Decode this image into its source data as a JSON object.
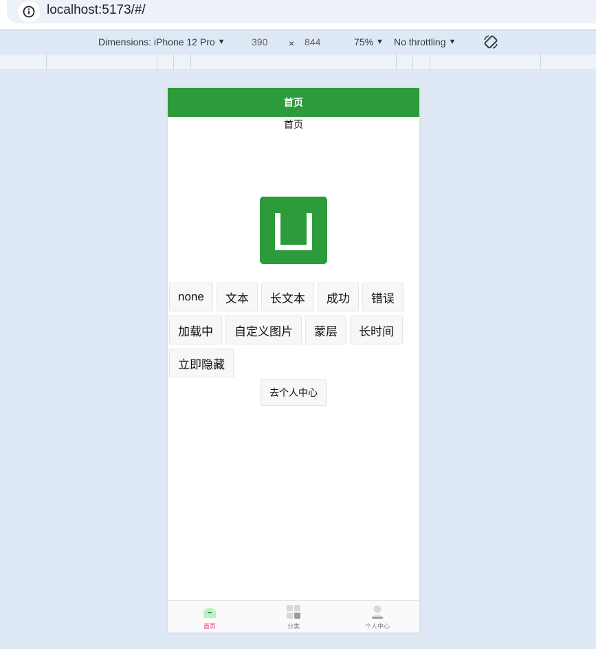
{
  "browser": {
    "url": "localhost:5173/#/"
  },
  "device_toolbar": {
    "dimensions_label": "Dimensions: iPhone 12 Pro",
    "width": "390",
    "times": "×",
    "height": "844",
    "zoom": "75%",
    "throttling": "No throttling",
    "rotate_icon": "rotate-icon"
  },
  "app": {
    "navbar_title": "首页",
    "page_heading": "首页",
    "logo_icon": "uni-app-logo",
    "buttons": [
      "none",
      "文本",
      "长文本",
      "成功",
      "错误",
      "加载中",
      "自定义图片",
      "蒙层",
      "长时间",
      "立即隐藏"
    ],
    "profile_button": "去个人中心",
    "tabs": [
      {
        "label": "首页",
        "icon": "home-icon",
        "active": true
      },
      {
        "label": "分类",
        "icon": "category-icon",
        "active": false
      },
      {
        "label": "个人中心",
        "icon": "user-icon",
        "active": false
      }
    ]
  },
  "colors": {
    "primary": "#2c9b3b",
    "tab_active": "#e02f8a",
    "tab_inactive": "#7a7e83"
  }
}
